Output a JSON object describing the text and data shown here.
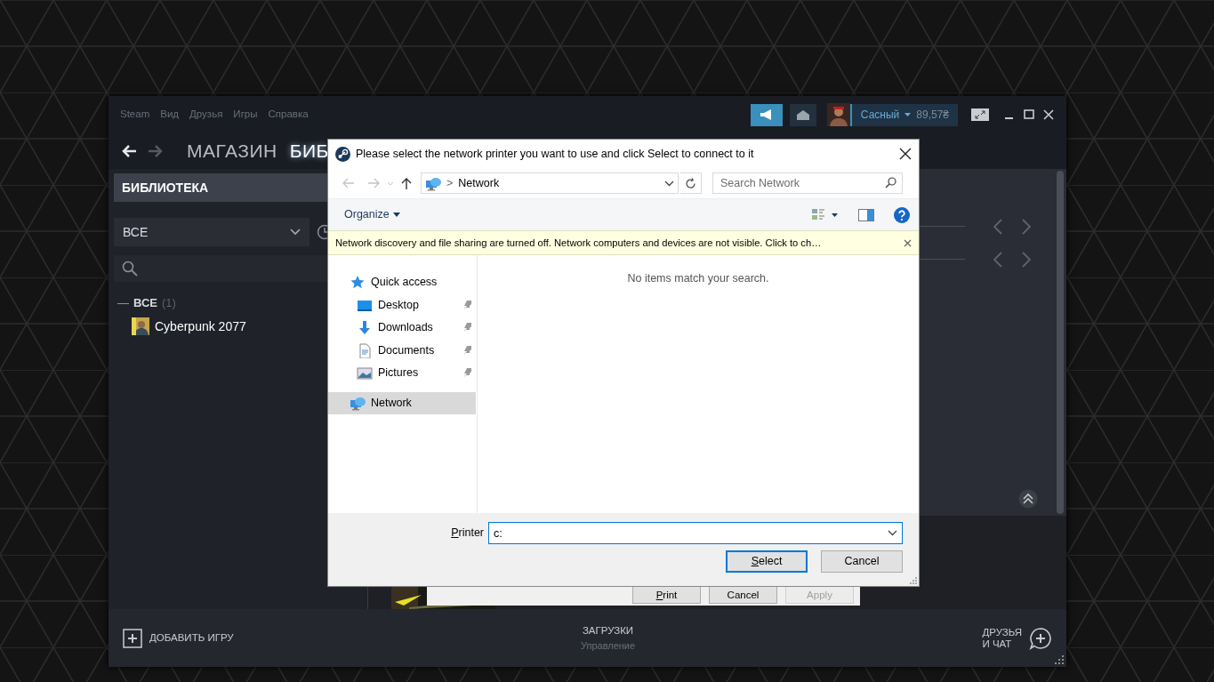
{
  "steam": {
    "menu": [
      "Steam",
      "Вид",
      "Друзья",
      "Игры",
      "Справка"
    ],
    "account": {
      "name": "Сасный",
      "balance": "89,57₴"
    },
    "history": {
      "back": true,
      "forward": false
    },
    "tabs": [
      {
        "label": "МАГАЗИН",
        "selected": false
      },
      {
        "label": "БИБ",
        "selected": true
      }
    ],
    "sidebar": {
      "home": "БИБЛИОТЕКА",
      "filter": "ВСЕ",
      "group": {
        "toggle": "—",
        "label": "ВСЕ",
        "count": "(1)"
      },
      "games": [
        {
          "name": "Cyberpunk 2077"
        }
      ]
    },
    "footer": {
      "add_game": "ДОБАВИТЬ ИГРУ",
      "downloads": "ЗАГРУЗКИ",
      "downloads_sub": "Управление",
      "friends": [
        "ДРУЗЬЯ",
        "И ЧАТ"
      ]
    }
  },
  "print_dialog": {
    "buttons": [
      {
        "label": "Print",
        "disabled": false
      },
      {
        "label": "Cancel",
        "disabled": false
      },
      {
        "label": "Apply",
        "disabled": true
      }
    ]
  },
  "dialog": {
    "title": "Please select the network printer you want to use and click Select to connect to it",
    "history": {
      "back": false,
      "forward": false
    },
    "address": {
      "separator": ">",
      "location": "Network"
    },
    "search": {
      "placeholder": "Search Network"
    },
    "organize": "Organize",
    "infobar": "Network discovery and file sharing are turned off. Network computers and devices are not visible. Click to ch…",
    "nav": [
      {
        "label": "Quick access",
        "kind": "quick",
        "pinned": false,
        "selected": false
      },
      {
        "label": "Desktop",
        "kind": "desktop",
        "pinned": true,
        "selected": false
      },
      {
        "label": "Downloads",
        "kind": "downloads",
        "pinned": true,
        "selected": false
      },
      {
        "label": "Documents",
        "kind": "documents",
        "pinned": true,
        "selected": false
      },
      {
        "label": "Pictures",
        "kind": "pictures",
        "pinned": true,
        "selected": false
      },
      {
        "label": "Network",
        "kind": "network",
        "pinned": false,
        "selected": true
      }
    ],
    "empty": "No items match your search.",
    "printer": {
      "label": "Printer",
      "value": "c:"
    },
    "buttons": [
      {
        "label": "Select",
        "default": true
      },
      {
        "label": "Cancel",
        "default": false
      }
    ]
  }
}
